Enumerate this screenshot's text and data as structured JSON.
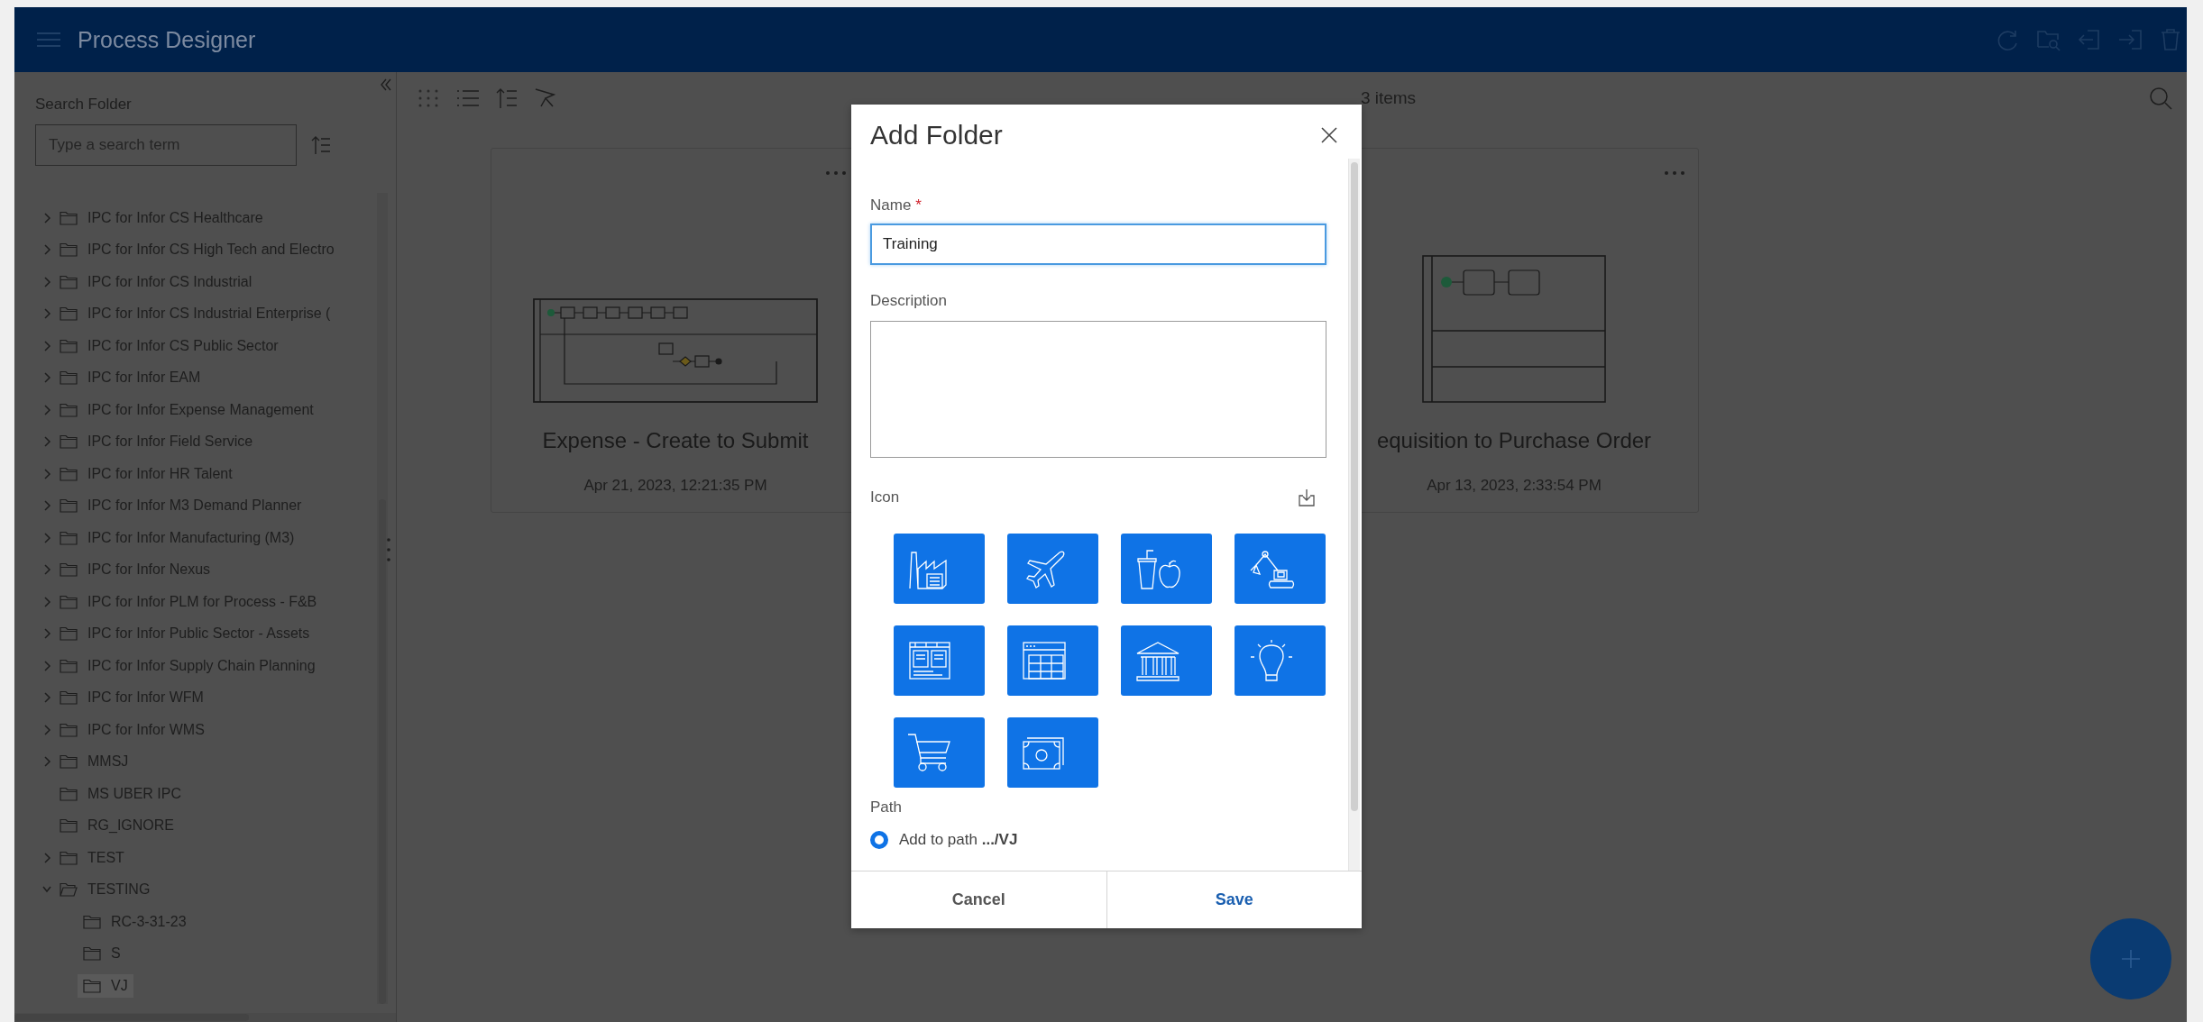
{
  "header": {
    "title": "Process Designer"
  },
  "sidebar": {
    "search_label": "Search Folder",
    "search": {
      "placeholder": "Type a search term"
    },
    "tree": [
      {
        "label": "IPC for Infor CS Healthcare",
        "expandable": true,
        "expanded": false,
        "selected": false
      },
      {
        "label": "IPC for Infor CS High Tech and Electro",
        "expandable": true,
        "expanded": false,
        "selected": false
      },
      {
        "label": "IPC for Infor CS Industrial",
        "expandable": true,
        "expanded": false,
        "selected": false
      },
      {
        "label": "IPC for Infor CS Industrial Enterprise (",
        "expandable": true,
        "expanded": false,
        "selected": false
      },
      {
        "label": "IPC for Infor CS Public Sector",
        "expandable": true,
        "expanded": false,
        "selected": false
      },
      {
        "label": "IPC for Infor EAM",
        "expandable": true,
        "expanded": false,
        "selected": false
      },
      {
        "label": "IPC for Infor Expense Management",
        "expandable": true,
        "expanded": false,
        "selected": false
      },
      {
        "label": "IPC for Infor Field Service",
        "expandable": true,
        "expanded": false,
        "selected": false
      },
      {
        "label": "IPC for Infor HR Talent",
        "expandable": true,
        "expanded": false,
        "selected": false
      },
      {
        "label": "IPC for Infor M3 Demand Planner",
        "expandable": true,
        "expanded": false,
        "selected": false
      },
      {
        "label": "IPC for Infor Manufacturing (M3)",
        "expandable": true,
        "expanded": false,
        "selected": false
      },
      {
        "label": "IPC for Infor Nexus",
        "expandable": true,
        "expanded": false,
        "selected": false
      },
      {
        "label": "IPC for Infor PLM for Process - F&B",
        "expandable": true,
        "expanded": false,
        "selected": false
      },
      {
        "label": "IPC for Infor Public Sector - Assets",
        "expandable": true,
        "expanded": false,
        "selected": false
      },
      {
        "label": "IPC for Infor Supply Chain Planning",
        "expandable": true,
        "expanded": false,
        "selected": false
      },
      {
        "label": "IPC for Infor WFM",
        "expandable": true,
        "expanded": false,
        "selected": false
      },
      {
        "label": "IPC for Infor WMS",
        "expandable": true,
        "expanded": false,
        "selected": false
      },
      {
        "label": "MMSJ",
        "expandable": true,
        "expanded": false,
        "selected": false
      },
      {
        "label": "MS UBER IPC",
        "expandable": false,
        "expanded": false,
        "selected": false
      },
      {
        "label": "RG_IGNORE",
        "expandable": false,
        "expanded": false,
        "selected": false
      },
      {
        "label": "TEST",
        "expandable": true,
        "expanded": false,
        "selected": false
      },
      {
        "label": "TESTING",
        "expandable": true,
        "expanded": true,
        "selected": false,
        "children": [
          {
            "label": "RC-3-31-23",
            "expandable": false,
            "expanded": false,
            "selected": false
          },
          {
            "label": "S",
            "expandable": false,
            "expanded": false,
            "selected": false
          },
          {
            "label": "VJ",
            "expandable": false,
            "expanded": false,
            "selected": true
          }
        ]
      }
    ]
  },
  "main": {
    "item_count": "3 items",
    "cards": [
      {
        "title": "Expense - Create to Submit",
        "date": "Apr 21, 2023, 12:21:35 PM",
        "kind": "two-lane"
      },
      {
        "title": "equisition to Purchase Order",
        "date": "Apr 13, 2023, 2:33:54 PM",
        "kind": "three-lane"
      }
    ]
  },
  "dialog": {
    "title": "Add Folder",
    "required_mark": "*",
    "name_field": {
      "label": "Name",
      "required": true,
      "value": "Training"
    },
    "description_field": {
      "label": "Description"
    },
    "icon_label": "Icon",
    "icons": [
      {
        "kind": "factory"
      },
      {
        "kind": "airplane"
      },
      {
        "kind": "food"
      },
      {
        "kind": "excavator"
      },
      {
        "kind": "dashboard"
      },
      {
        "kind": "spreadsheet"
      },
      {
        "kind": "bank"
      },
      {
        "kind": "lightbulb"
      },
      {
        "kind": "cart"
      },
      {
        "kind": "money"
      }
    ],
    "path": {
      "label": "Path",
      "option": {
        "text": "Add to path **.../VJ**",
        "selected": true
      }
    },
    "buttons": [
      {
        "label": "Cancel",
        "kind": "secondary"
      },
      {
        "label": "Save",
        "kind": "primary"
      }
    ]
  }
}
